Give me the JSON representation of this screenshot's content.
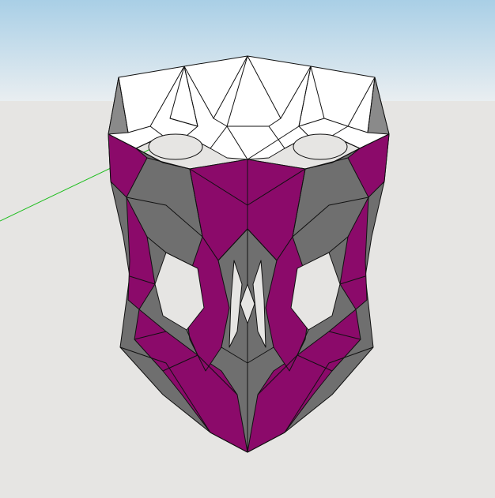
{
  "scene": {
    "type": "3d-model-viewport",
    "background": {
      "sky_top": "#a9cfe6",
      "sky_bottom": "#e9eef1",
      "ground": "#e6e5e3"
    },
    "axis_color": "#1fbe1f",
    "model": {
      "description_visible": false,
      "face_colors": {
        "top": "#ffffff",
        "side_dark": "#6e6e6e",
        "side_mid": "#7a7a7a",
        "accent": "#8b0a6a"
      },
      "edge_color": "#111111"
    }
  }
}
